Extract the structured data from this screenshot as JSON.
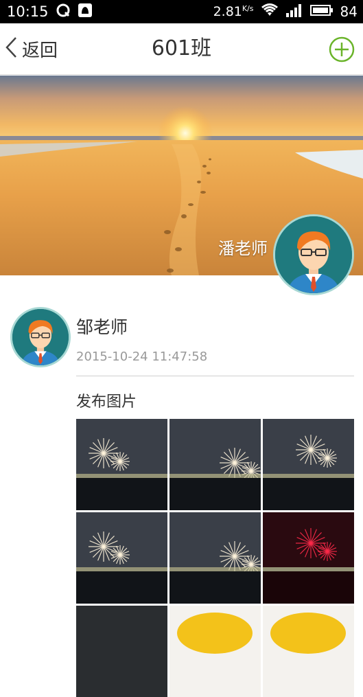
{
  "status_bar": {
    "time": "10:15",
    "network_speed": "2.81",
    "network_speed_unit": "K/s",
    "battery": "84",
    "icons": [
      "q-app-icon",
      "notification-app-icon",
      "wifi-icon",
      "signal-icon",
      "battery-icon"
    ]
  },
  "nav": {
    "back_label": "返回",
    "title": "601班",
    "add_icon": "plus-circle-icon",
    "accent_color": "#6ab42a"
  },
  "banner": {
    "teacher_name": "潘老师"
  },
  "post": {
    "author": "邹老师",
    "timestamp": "2015-10-24 11:47:58",
    "type_label": "发布图片",
    "photos": [
      {
        "kind": "fireworks-night"
      },
      {
        "kind": "fireworks-night"
      },
      {
        "kind": "fireworks-night"
      },
      {
        "kind": "fireworks-night"
      },
      {
        "kind": "fireworks-night"
      },
      {
        "kind": "fireworks-red"
      },
      {
        "kind": "night-dark"
      },
      {
        "kind": "food-yellow"
      },
      {
        "kind": "food-yellow"
      }
    ]
  }
}
